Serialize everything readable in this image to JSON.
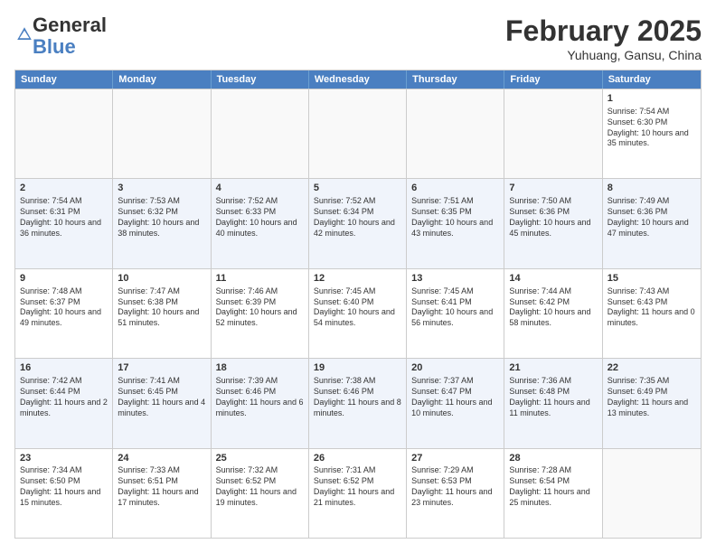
{
  "header": {
    "logo_general": "General",
    "logo_blue": "Blue",
    "month_title": "February 2025",
    "location": "Yuhuang, Gansu, China"
  },
  "weekdays": [
    "Sunday",
    "Monday",
    "Tuesday",
    "Wednesday",
    "Thursday",
    "Friday",
    "Saturday"
  ],
  "rows": [
    [
      {
        "day": "",
        "info": ""
      },
      {
        "day": "",
        "info": ""
      },
      {
        "day": "",
        "info": ""
      },
      {
        "day": "",
        "info": ""
      },
      {
        "day": "",
        "info": ""
      },
      {
        "day": "",
        "info": ""
      },
      {
        "day": "1",
        "info": "Sunrise: 7:54 AM\nSunset: 6:30 PM\nDaylight: 10 hours and 35 minutes."
      }
    ],
    [
      {
        "day": "2",
        "info": "Sunrise: 7:54 AM\nSunset: 6:31 PM\nDaylight: 10 hours and 36 minutes."
      },
      {
        "day": "3",
        "info": "Sunrise: 7:53 AM\nSunset: 6:32 PM\nDaylight: 10 hours and 38 minutes."
      },
      {
        "day": "4",
        "info": "Sunrise: 7:52 AM\nSunset: 6:33 PM\nDaylight: 10 hours and 40 minutes."
      },
      {
        "day": "5",
        "info": "Sunrise: 7:52 AM\nSunset: 6:34 PM\nDaylight: 10 hours and 42 minutes."
      },
      {
        "day": "6",
        "info": "Sunrise: 7:51 AM\nSunset: 6:35 PM\nDaylight: 10 hours and 43 minutes."
      },
      {
        "day": "7",
        "info": "Sunrise: 7:50 AM\nSunset: 6:36 PM\nDaylight: 10 hours and 45 minutes."
      },
      {
        "day": "8",
        "info": "Sunrise: 7:49 AM\nSunset: 6:36 PM\nDaylight: 10 hours and 47 minutes."
      }
    ],
    [
      {
        "day": "9",
        "info": "Sunrise: 7:48 AM\nSunset: 6:37 PM\nDaylight: 10 hours and 49 minutes."
      },
      {
        "day": "10",
        "info": "Sunrise: 7:47 AM\nSunset: 6:38 PM\nDaylight: 10 hours and 51 minutes."
      },
      {
        "day": "11",
        "info": "Sunrise: 7:46 AM\nSunset: 6:39 PM\nDaylight: 10 hours and 52 minutes."
      },
      {
        "day": "12",
        "info": "Sunrise: 7:45 AM\nSunset: 6:40 PM\nDaylight: 10 hours and 54 minutes."
      },
      {
        "day": "13",
        "info": "Sunrise: 7:45 AM\nSunset: 6:41 PM\nDaylight: 10 hours and 56 minutes."
      },
      {
        "day": "14",
        "info": "Sunrise: 7:44 AM\nSunset: 6:42 PM\nDaylight: 10 hours and 58 minutes."
      },
      {
        "day": "15",
        "info": "Sunrise: 7:43 AM\nSunset: 6:43 PM\nDaylight: 11 hours and 0 minutes."
      }
    ],
    [
      {
        "day": "16",
        "info": "Sunrise: 7:42 AM\nSunset: 6:44 PM\nDaylight: 11 hours and 2 minutes."
      },
      {
        "day": "17",
        "info": "Sunrise: 7:41 AM\nSunset: 6:45 PM\nDaylight: 11 hours and 4 minutes."
      },
      {
        "day": "18",
        "info": "Sunrise: 7:39 AM\nSunset: 6:46 PM\nDaylight: 11 hours and 6 minutes."
      },
      {
        "day": "19",
        "info": "Sunrise: 7:38 AM\nSunset: 6:46 PM\nDaylight: 11 hours and 8 minutes."
      },
      {
        "day": "20",
        "info": "Sunrise: 7:37 AM\nSunset: 6:47 PM\nDaylight: 11 hours and 10 minutes."
      },
      {
        "day": "21",
        "info": "Sunrise: 7:36 AM\nSunset: 6:48 PM\nDaylight: 11 hours and 11 minutes."
      },
      {
        "day": "22",
        "info": "Sunrise: 7:35 AM\nSunset: 6:49 PM\nDaylight: 11 hours and 13 minutes."
      }
    ],
    [
      {
        "day": "23",
        "info": "Sunrise: 7:34 AM\nSunset: 6:50 PM\nDaylight: 11 hours and 15 minutes."
      },
      {
        "day": "24",
        "info": "Sunrise: 7:33 AM\nSunset: 6:51 PM\nDaylight: 11 hours and 17 minutes."
      },
      {
        "day": "25",
        "info": "Sunrise: 7:32 AM\nSunset: 6:52 PM\nDaylight: 11 hours and 19 minutes."
      },
      {
        "day": "26",
        "info": "Sunrise: 7:31 AM\nSunset: 6:52 PM\nDaylight: 11 hours and 21 minutes."
      },
      {
        "day": "27",
        "info": "Sunrise: 7:29 AM\nSunset: 6:53 PM\nDaylight: 11 hours and 23 minutes."
      },
      {
        "day": "28",
        "info": "Sunrise: 7:28 AM\nSunset: 6:54 PM\nDaylight: 11 hours and 25 minutes."
      },
      {
        "day": "",
        "info": ""
      }
    ]
  ]
}
